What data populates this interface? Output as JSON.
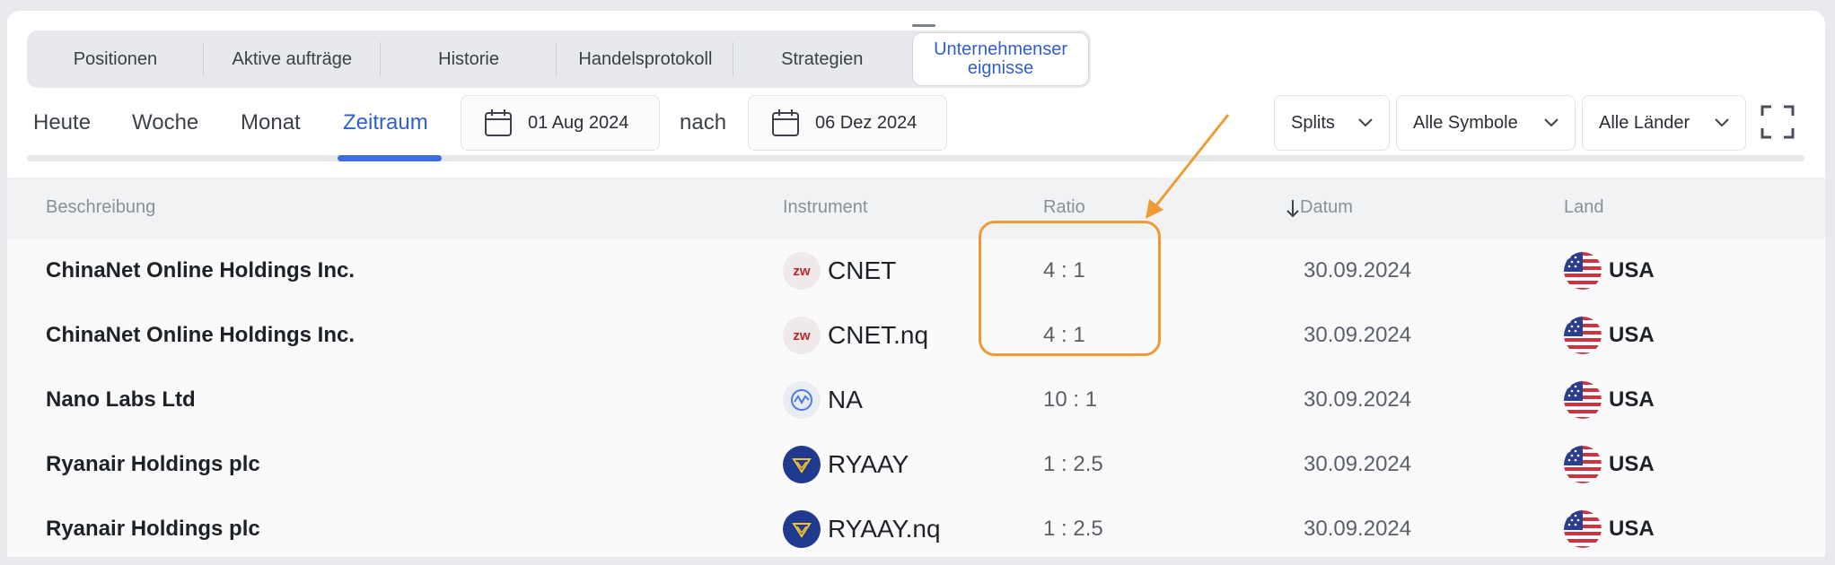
{
  "tabs": [
    {
      "label": "Positionen",
      "active": false
    },
    {
      "label": "Aktive aufträge",
      "active": false
    },
    {
      "label": "Historie",
      "active": false
    },
    {
      "label": "Handelsprotokoll",
      "active": false
    },
    {
      "label": "Strategien",
      "active": false
    },
    {
      "label": "Unternehmenser eignisse",
      "line1": "Unternehmenser",
      "line2": "eignisse",
      "active": true
    }
  ],
  "periods": {
    "today": "Heute",
    "week": "Woche",
    "month": "Monat",
    "range": "Zeitraum",
    "active": "Zeitraum"
  },
  "date_from": "01 Aug 2024",
  "date_sep": "nach",
  "date_to": "06 Dez 2024",
  "filters": {
    "type": "Splits",
    "symbols": "Alle Symbole",
    "countries": "Alle Länder"
  },
  "columns": {
    "description": "Beschreibung",
    "instrument": "Instrument",
    "ratio": "Ratio",
    "date": "Datum",
    "country": "Land",
    "sort_column": "Datum",
    "sort_dir": "desc"
  },
  "rows": [
    {
      "description": "ChinaNet Online Holdings Inc.",
      "logo": "zw-logo",
      "logo_text": "zw",
      "instrument": "CNET",
      "ratio": "4 : 1",
      "date": "30.09.2024",
      "country": "USA",
      "flag": "us-flag-icon"
    },
    {
      "description": "ChinaNet Online Holdings Inc.",
      "logo": "zw-logo",
      "logo_text": "zw",
      "instrument": "CNET.nq",
      "ratio": "4 : 1",
      "date": "30.09.2024",
      "country": "USA",
      "flag": "us-flag-icon"
    },
    {
      "description": "Nano Labs Ltd",
      "logo": "nano-labs-logo",
      "logo_text": "",
      "instrument": "NA",
      "ratio": "10 : 1",
      "date": "30.09.2024",
      "country": "USA",
      "flag": "us-flag-icon"
    },
    {
      "description": "Ryanair Holdings plc",
      "logo": "ryanair-logo",
      "logo_text": "",
      "instrument": "RYAAY",
      "ratio": "1 : 2.5",
      "date": "30.09.2024",
      "country": "USA",
      "flag": "us-flag-icon"
    },
    {
      "description": "Ryanair Holdings plc",
      "logo": "ryanair-logo",
      "logo_text": "",
      "instrument": "RYAAY.nq",
      "ratio": "1 : 2.5",
      "date": "30.09.2024",
      "country": "USA",
      "flag": "us-flag-icon"
    }
  ],
  "annotation": {
    "color": "#ef9a32",
    "highlighted_rows": [
      0,
      1
    ],
    "highlighted_column": "Ratio"
  },
  "colors": {
    "accent": "#3d6ce0",
    "annotation": "#ef9a32",
    "background": "#e9eaed"
  }
}
